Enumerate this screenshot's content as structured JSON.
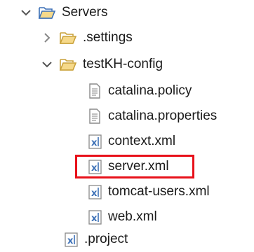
{
  "tree": {
    "root": {
      "label": "Servers",
      "icon": "folder-open-icon",
      "expanded": true
    },
    "items": [
      {
        "label": ".settings",
        "icon": "folder-icon",
        "expanded": false
      },
      {
        "label": "testKH-config",
        "icon": "folder-open-icon",
        "expanded": true
      },
      {
        "label": "catalina.policy",
        "icon": "text-file-icon"
      },
      {
        "label": "catalina.properties",
        "icon": "text-file-icon"
      },
      {
        "label": "context.xml",
        "icon": "xml-file-icon"
      },
      {
        "label": "server.xml",
        "icon": "xml-file-icon",
        "highlighted": true
      },
      {
        "label": "tomcat-users.xml",
        "icon": "xml-file-icon"
      },
      {
        "label": "web.xml",
        "icon": "xml-file-icon"
      },
      {
        "label": ".project",
        "icon": "xml-file-icon"
      }
    ]
  },
  "colors": {
    "highlight_border": "#e8111a",
    "folder_stroke": "#3b6fb6",
    "folder_fill": "#f6d98a",
    "xml_badge": "#3b6fb6"
  }
}
